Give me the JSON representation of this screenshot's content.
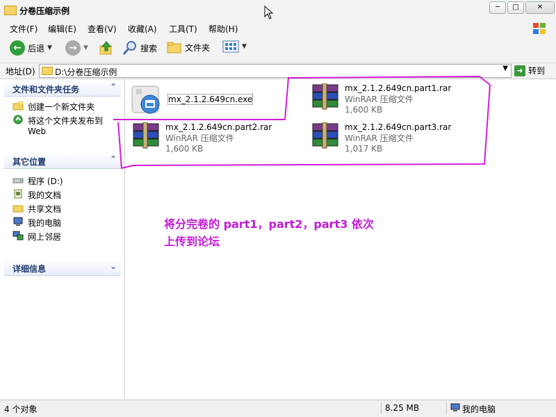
{
  "window": {
    "title": "分卷压缩示例"
  },
  "title_buttons": {
    "minimize": "─",
    "maximize": "□",
    "close": "✕"
  },
  "menu": [
    "文件(F)",
    "编辑(E)",
    "查看(V)",
    "收藏(A)",
    "工具(T)",
    "帮助(H)"
  ],
  "toolbar": {
    "back": "后退",
    "search": "搜索",
    "folders": "文件夹"
  },
  "address": {
    "label": "地址(D)",
    "path": "D:\\分卷压缩示例",
    "go": "转到"
  },
  "tasks_panel": {
    "title": "文件和文件夹任务",
    "items": [
      "创建一个新文件夹",
      "将这个文件夹发布到",
      "Web"
    ]
  },
  "places_panel": {
    "title": "其它位置",
    "items": [
      "程序 (D:)",
      "我的文档",
      "共享文档",
      "我的电脑",
      "网上邻居"
    ]
  },
  "details_panel": {
    "title": "详细信息"
  },
  "files": [
    {
      "name": "mx_2.1.2.649cn.exe",
      "type": "",
      "size": ""
    },
    {
      "name": "mx_2.1.2.649cn.part1.rar",
      "type": "WinRAR 压缩文件",
      "size": "1,600 KB"
    },
    {
      "name": "mx_2.1.2.649cn.part2.rar",
      "type": "WinRAR 压缩文件",
      "size": "1,600 KB"
    },
    {
      "name": "mx_2.1.2.649cn.part3.rar",
      "type": "WinRAR 压缩文件",
      "size": "1,017 KB"
    }
  ],
  "annotation": {
    "line1": "将分完卷的 part1，part2，part3 依次",
    "line2": "上传到论坛"
  },
  "status": {
    "count": "4 个对象",
    "size": "8.25 MB",
    "location": "我的电脑"
  },
  "colors": {
    "annotation": "#c31ad8",
    "panel_title": "#1f3a70"
  }
}
